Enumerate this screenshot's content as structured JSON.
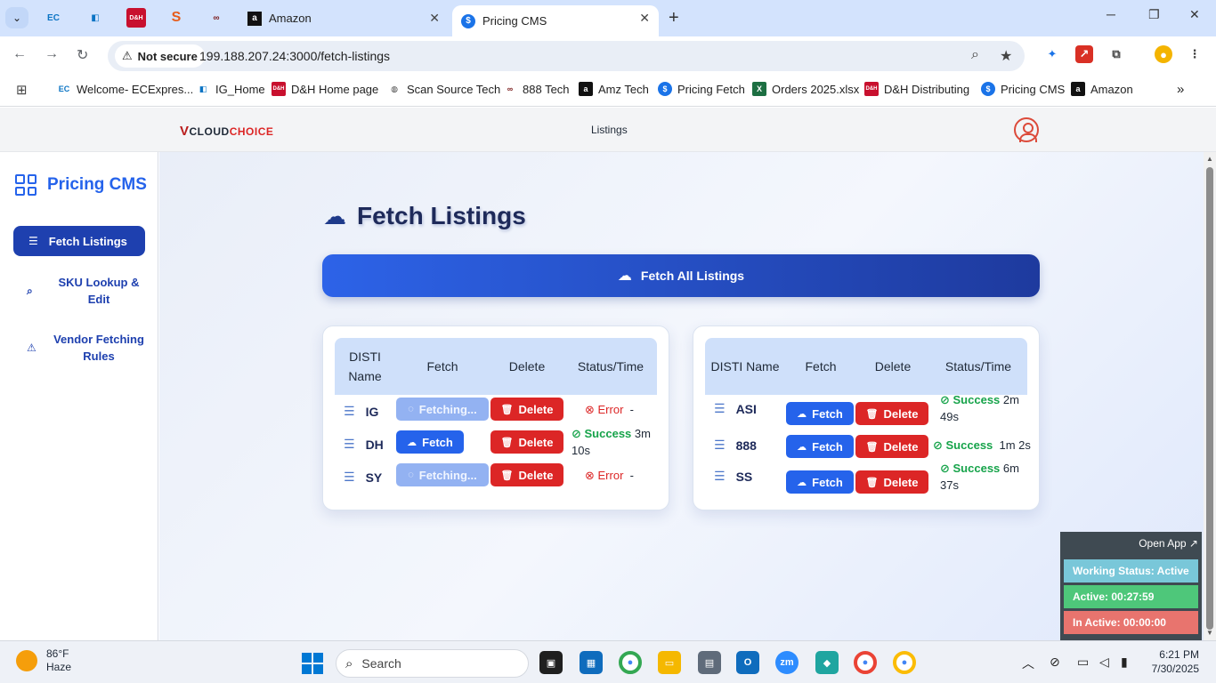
{
  "browser": {
    "tabs": [
      {
        "title": "Amazon",
        "active": false
      },
      {
        "title": "Pricing CMS",
        "active": true
      }
    ],
    "security_label": "Not secure",
    "url": "199.188.207.24:3000/fetch-listings",
    "bookmarks": [
      "Welcome- ECExpres...",
      "IG_Home",
      "D&H Home page",
      "Scan Source Tech",
      "888 Tech",
      "Amz Tech",
      "Pricing Fetch",
      "Orders 2025.xlsx",
      "D&H Distributing",
      "Pricing CMS",
      "Amazon"
    ]
  },
  "app": {
    "logo": {
      "v": "V",
      "cloud": "CLOUD",
      "choice": "CHOICE"
    },
    "nav_listings": "Listings",
    "brand": "Pricing CMS",
    "sidebar": {
      "active_label": "Fetch Listings",
      "items": [
        {
          "label": "SKU Lookup & Edit"
        },
        {
          "label": "Vendor Fetching Rules"
        }
      ]
    },
    "page_title": "Fetch Listings",
    "fetch_all_label": "Fetch All Listings",
    "table_headers": {
      "name": "DISTI Name",
      "fetch": "Fetch",
      "delete": "Delete",
      "status": "Status/Time"
    },
    "left_table": [
      {
        "name": "IG",
        "fetch": "Fetching...",
        "delete": "Delete",
        "status": "Error",
        "time": "-"
      },
      {
        "name": "DH",
        "fetch": "Fetch",
        "delete": "Delete",
        "status": "Success",
        "time": "3m 10s"
      },
      {
        "name": "SY",
        "fetch": "Fetching...",
        "delete": "Delete",
        "status": "Error",
        "time": "-"
      }
    ],
    "right_table": [
      {
        "name": "ASI",
        "fetch": "Fetch",
        "delete": "Delete",
        "status": "Success",
        "time": "2m 49s"
      },
      {
        "name": "888",
        "fetch": "Fetch",
        "delete": "Delete",
        "status": "Success",
        "time": "1m 2s"
      },
      {
        "name": "SS",
        "fetch": "Fetch",
        "delete": "Delete",
        "status": "Success",
        "time": "6m 37s"
      }
    ]
  },
  "widget": {
    "open_app": "Open App ↗",
    "working_status": "Working Status: Active",
    "active": "Active: 00:27:59",
    "inactive": "In Active: 00:00:00",
    "colors": {
      "working": "#79c7d9",
      "active": "#4ec77a",
      "inactive": "#e8746e"
    }
  },
  "taskbar": {
    "temp": "86°F",
    "condition": "Haze",
    "search_placeholder": "Search",
    "time": "6:21 PM",
    "date": "7/30/2025"
  },
  "colors": {
    "accent": "#2563eb",
    "dark_accent": "#1e40af",
    "danger": "#dc2626",
    "success": "#16a34a"
  }
}
